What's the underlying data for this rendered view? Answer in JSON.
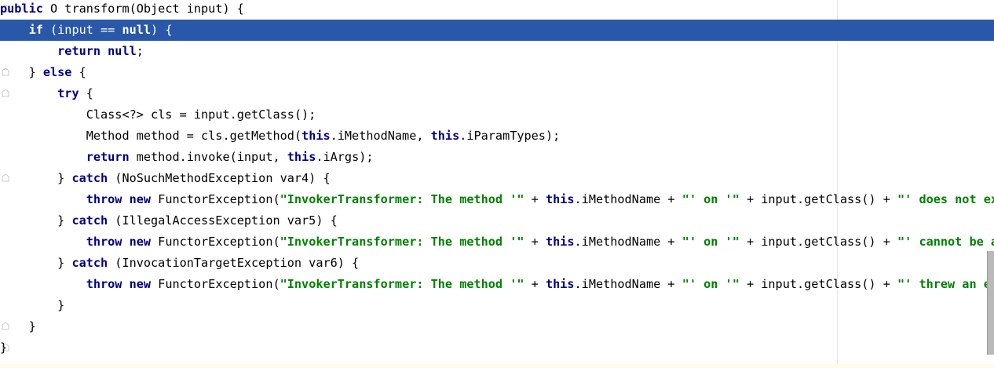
{
  "editor": {
    "lines": [
      [
        {
          "t": "public",
          "c": "kw"
        },
        {
          "t": " O transform(Object input) {",
          "c": ""
        }
      ],
      [
        {
          "t": "    ",
          "c": ""
        },
        {
          "t": "if",
          "c": "kw"
        },
        {
          "t": " (input == ",
          "c": ""
        },
        {
          "t": "null",
          "c": "kw"
        },
        {
          "t": ") {",
          "c": ""
        }
      ],
      [
        {
          "t": "        ",
          "c": ""
        },
        {
          "t": "return null",
          "c": "kw"
        },
        {
          "t": ";",
          "c": ""
        }
      ],
      [
        {
          "t": "    } ",
          "c": ""
        },
        {
          "t": "else",
          "c": "kw"
        },
        {
          "t": " {",
          "c": ""
        }
      ],
      [
        {
          "t": "        ",
          "c": ""
        },
        {
          "t": "try",
          "c": "kw"
        },
        {
          "t": " {",
          "c": ""
        }
      ],
      [
        {
          "t": "            Class<?> cls = input.getClass();",
          "c": ""
        }
      ],
      [
        {
          "t": "            Method method = cls.getMethod(",
          "c": ""
        },
        {
          "t": "this",
          "c": "kw"
        },
        {
          "t": ".iMethodName, ",
          "c": ""
        },
        {
          "t": "this",
          "c": "kw"
        },
        {
          "t": ".iParamTypes);",
          "c": ""
        }
      ],
      [
        {
          "t": "            ",
          "c": ""
        },
        {
          "t": "return",
          "c": "kw"
        },
        {
          "t": " method.invoke(input, ",
          "c": ""
        },
        {
          "t": "this",
          "c": "kw"
        },
        {
          "t": ".iArgs);",
          "c": ""
        }
      ],
      [
        {
          "t": "        } ",
          "c": ""
        },
        {
          "t": "catch",
          "c": "kw"
        },
        {
          "t": " (NoSuchMethodException var4) {",
          "c": ""
        }
      ],
      [
        {
          "t": "            ",
          "c": ""
        },
        {
          "t": "throw new",
          "c": "kw"
        },
        {
          "t": " FunctorException(",
          "c": ""
        },
        {
          "t": "\"InvokerTransformer: The method '\"",
          "c": "str"
        },
        {
          "t": " + ",
          "c": ""
        },
        {
          "t": "this",
          "c": "kw"
        },
        {
          "t": ".iMethodName + ",
          "c": ""
        },
        {
          "t": "\"' on '\"",
          "c": "str"
        },
        {
          "t": " + input.getClass() + ",
          "c": ""
        },
        {
          "t": "\"' does not ex",
          "c": "str"
        }
      ],
      [
        {
          "t": "        } ",
          "c": ""
        },
        {
          "t": "catch",
          "c": "kw"
        },
        {
          "t": " (IllegalAccessException var5) {",
          "c": ""
        }
      ],
      [
        {
          "t": "            ",
          "c": ""
        },
        {
          "t": "throw new",
          "c": "kw"
        },
        {
          "t": " FunctorException(",
          "c": ""
        },
        {
          "t": "\"InvokerTransformer: The method '\"",
          "c": "str"
        },
        {
          "t": " + ",
          "c": ""
        },
        {
          "t": "this",
          "c": "kw"
        },
        {
          "t": ".iMethodName + ",
          "c": ""
        },
        {
          "t": "\"' on '\"",
          "c": "str"
        },
        {
          "t": " + input.getClass() + ",
          "c": ""
        },
        {
          "t": "\"' cannot be a",
          "c": "str"
        }
      ],
      [
        {
          "t": "        } ",
          "c": ""
        },
        {
          "t": "catch",
          "c": "kw"
        },
        {
          "t": " (InvocationTargetException var6) {",
          "c": ""
        }
      ],
      [
        {
          "t": "            ",
          "c": ""
        },
        {
          "t": "throw new",
          "c": "kw"
        },
        {
          "t": " FunctorException(",
          "c": ""
        },
        {
          "t": "\"InvokerTransformer: The method '\"",
          "c": "str"
        },
        {
          "t": " + ",
          "c": ""
        },
        {
          "t": "this",
          "c": "kw"
        },
        {
          "t": ".iMethodName + ",
          "c": ""
        },
        {
          "t": "\"' on '\"",
          "c": "str"
        },
        {
          "t": " + input.getClass() + ",
          "c": ""
        },
        {
          "t": "\"' threw an ex",
          "c": "str"
        }
      ],
      [
        {
          "t": "        }",
          "c": ""
        }
      ],
      [
        {
          "t": "    }",
          "c": ""
        }
      ],
      [
        {
          "t": "}",
          "c": ""
        }
      ]
    ],
    "selected_line": 1,
    "fold_markers": [
      0,
      1,
      3,
      4,
      8,
      15,
      16
    ],
    "colors": {
      "selection": "#2a58a8",
      "keyword": "#000080",
      "string": "#008000"
    }
  }
}
